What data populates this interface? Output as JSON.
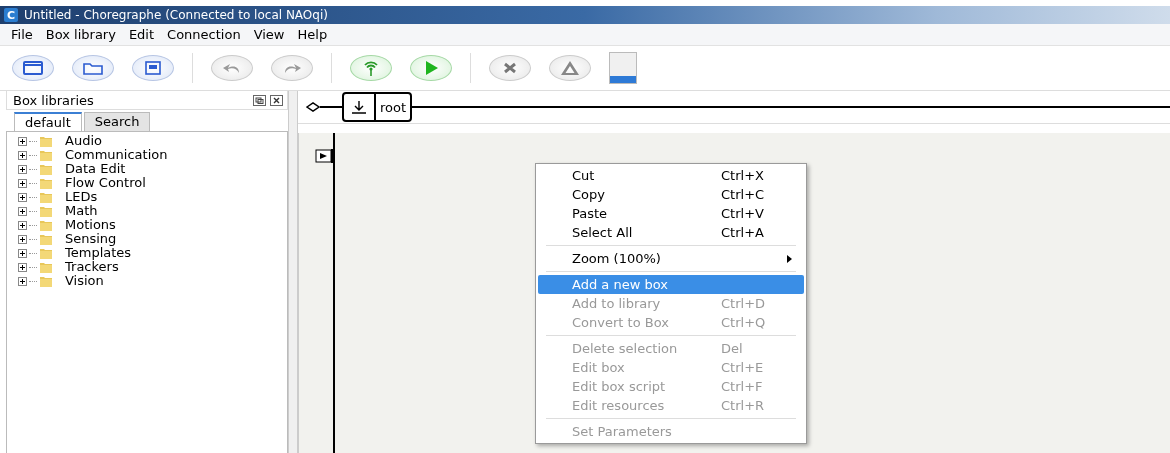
{
  "window": {
    "title": "Untitled - Choregraphe (Connected to local NAOqi)",
    "app_icon": "C"
  },
  "menu_bar": [
    "File",
    "Box library",
    "Edit",
    "Connection",
    "View",
    "Help"
  ],
  "toolbar": [
    {
      "kind": "new",
      "disabled": false
    },
    {
      "kind": "open",
      "disabled": false
    },
    {
      "kind": "save",
      "disabled": false
    },
    {
      "kind": "sep"
    },
    {
      "kind": "undo",
      "disabled": true
    },
    {
      "kind": "redo",
      "disabled": true
    },
    {
      "kind": "sep"
    },
    {
      "kind": "connect",
      "disabled": false
    },
    {
      "kind": "play",
      "disabled": false
    },
    {
      "kind": "sep"
    },
    {
      "kind": "stop",
      "disabled": true
    },
    {
      "kind": "warning",
      "disabled": true
    },
    {
      "kind": "meter",
      "level": 0.25
    }
  ],
  "box_libraries": {
    "title": "Box libraries",
    "tabs": [
      {
        "label": "default",
        "selected": true
      },
      {
        "label": "Search",
        "selected": false
      }
    ],
    "items": [
      {
        "label": "Audio",
        "expanded": false
      },
      {
        "label": "Communication",
        "expanded": false
      },
      {
        "label": "Data Edit",
        "expanded": false
      },
      {
        "label": "Flow Control",
        "expanded": false
      },
      {
        "label": "LEDs",
        "expanded": false
      },
      {
        "label": "Math",
        "expanded": false
      },
      {
        "label": "Motions",
        "expanded": false
      },
      {
        "label": "Sensing",
        "expanded": false
      },
      {
        "label": "Templates",
        "expanded": false
      },
      {
        "label": "Trackers",
        "expanded": false
      },
      {
        "label": "Vision",
        "expanded": false
      }
    ]
  },
  "breadcrumb": {
    "label": "root"
  },
  "context_menu": [
    {
      "kind": "item",
      "label": "Cut",
      "shortcut": "Ctrl+X",
      "disabled": false,
      "selected": false
    },
    {
      "kind": "item",
      "label": "Copy",
      "shortcut": "Ctrl+C",
      "disabled": false,
      "selected": false
    },
    {
      "kind": "item",
      "label": "Paste",
      "shortcut": "Ctrl+V",
      "disabled": false,
      "selected": false
    },
    {
      "kind": "item",
      "label": "Select All",
      "shortcut": "Ctrl+A",
      "disabled": false,
      "selected": false
    },
    {
      "kind": "separator"
    },
    {
      "kind": "submenu",
      "label": "Zoom (100%)",
      "disabled": false,
      "selected": false
    },
    {
      "kind": "separator"
    },
    {
      "kind": "item",
      "label": "Add a new box",
      "disabled": false,
      "selected": true
    },
    {
      "kind": "item",
      "label": "Add to library",
      "shortcut": "Ctrl+D",
      "disabled": true,
      "selected": false
    },
    {
      "kind": "item",
      "label": "Convert to Box",
      "shortcut": "Ctrl+Q",
      "disabled": true,
      "selected": false
    },
    {
      "kind": "separator"
    },
    {
      "kind": "item",
      "label": "Delete selection",
      "shortcut": "Del",
      "disabled": true,
      "selected": false
    },
    {
      "kind": "item",
      "label": "Edit box",
      "shortcut": "Ctrl+E",
      "disabled": true,
      "selected": false
    },
    {
      "kind": "item",
      "label": "Edit box script",
      "shortcut": "Ctrl+F",
      "disabled": true,
      "selected": false
    },
    {
      "kind": "item",
      "label": "Edit resources",
      "shortcut": "Ctrl+R",
      "disabled": true,
      "selected": false
    },
    {
      "kind": "separator"
    },
    {
      "kind": "item",
      "label": "Set Parameters",
      "disabled": true,
      "selected": false
    }
  ]
}
